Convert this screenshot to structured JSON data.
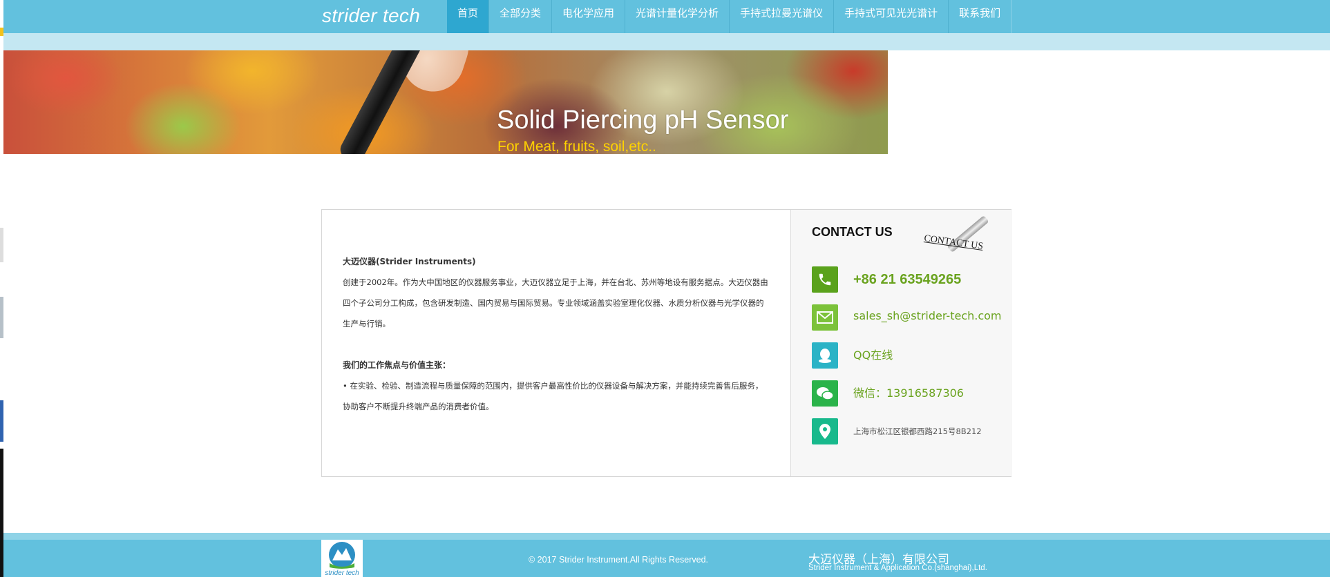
{
  "header": {
    "logo_text": "strider tech",
    "nav": [
      {
        "label": "首页",
        "active": true
      },
      {
        "label": "全部分类",
        "active": false
      },
      {
        "label": "电化学应用",
        "active": false
      },
      {
        "label": "光谱计量化学分析",
        "active": false
      },
      {
        "label": "手持式拉曼光谱仪",
        "active": false
      },
      {
        "label": "手持式可见光光谱计",
        "active": false
      },
      {
        "label": "联系我们",
        "active": false
      }
    ]
  },
  "banner": {
    "title": "Solid Piercing pH Sensor",
    "subtitle": "For Meat, fruits, soil,etc.."
  },
  "about": {
    "heading": "大迈仪器(Strider Instruments)",
    "intro": "创建于2002年。作为大中国地区的仪器服务事业，大迈仪器立足于上海，并在台北、苏州等地设有服务据点。大迈仪器由四个子公司分工构成，包含研发制造、国内贸易与国际贸易。专业领域涵盖实验室理化仪器、水质分析仪器与光学仪器的生产与行销。",
    "focus_heading": "我们的工作焦点与价值主张：",
    "focus_text": "• 在实验、检验、制造流程与质量保障的范围内，提供客户最高性价比的仪器设备与解决方案，并能持续完善售后服务，协助客户不断提升终端产品的消费者价值。"
  },
  "contact": {
    "title": "CONTACT US",
    "decoration_text": "CONTACT US",
    "phone": "+86 21 63549265",
    "email": "sales_sh@strider-tech.com",
    "qq": "QQ在线",
    "wechat": "微信：13916587306",
    "address": "上海市松江区银都西路215号8B212"
  },
  "footer": {
    "logo_text": "strider tech",
    "copyright": "© 2017 Strider Instrument.All Rights Reserved.",
    "company_cn": "大迈仪器（上海）有限公司",
    "company_en": "Strider Instrument & Application Co.(shanghai),Ltd."
  },
  "colors": {
    "header": "#62c1de",
    "subbar": "#c4e7f2",
    "nav_active": "#2ea7d0",
    "accent_green": "#6aa31f",
    "phone_icon": "#5aa21c",
    "email_icon": "#7cc23a",
    "qq_icon": "#2bb3c6",
    "wechat_icon": "#2bb34a",
    "map_icon": "#18b98c",
    "banner_subtitle": "#ffd200"
  }
}
